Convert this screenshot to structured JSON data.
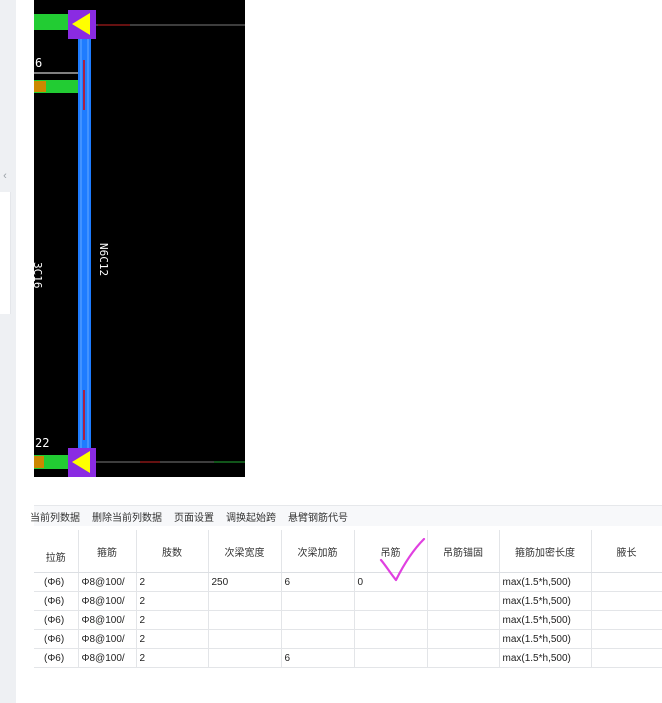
{
  "cad": {
    "label_top_left": "6",
    "label_vertical_left": "3C16",
    "label_vertical_beam": "N6C12",
    "label_bottom_left": "22"
  },
  "toolbar": {
    "items": [
      "当前列数据",
      "删除当前列数据",
      "页面设置",
      "调换起始跨",
      "悬臂钢筋代号"
    ]
  },
  "table": {
    "headers": [
      "拉筋",
      "箍筋",
      "肢数",
      "次梁宽度",
      "次梁加筋",
      "吊筋",
      "吊筋锚固",
      "箍筋加密长度",
      "腋长"
    ],
    "rows": [
      [
        "(Φ6)",
        "Φ8@100/",
        "2",
        "250",
        "6",
        "0",
        "",
        "max(1.5*h,500)",
        ""
      ],
      [
        "(Φ6)",
        "Φ8@100/",
        "2",
        "",
        "",
        "",
        "",
        "max(1.5*h,500)",
        ""
      ],
      [
        "(Φ6)",
        "Φ8@100/",
        "2",
        "",
        "",
        "",
        "",
        "max(1.5*h,500)",
        ""
      ],
      [
        "(Φ6)",
        "Φ8@100/",
        "2",
        "",
        "",
        "",
        "",
        "max(1.5*h,500)",
        ""
      ],
      [
        "(Φ6)",
        "Φ8@100/",
        "2",
        "",
        "6",
        "",
        "",
        "max(1.5*h,500)",
        ""
      ]
    ]
  },
  "colors": {
    "beam": "#1e7cff",
    "support": "#8a2be2",
    "triangle": "#ffff00",
    "rebar": "#22cc33",
    "annotation": "#e040e0"
  }
}
